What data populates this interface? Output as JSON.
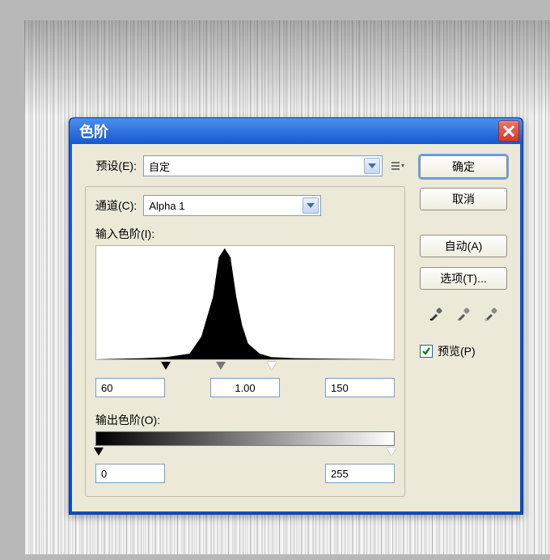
{
  "dialog": {
    "title": "色阶",
    "preset_label": "预设(E):",
    "preset_value": "自定",
    "channel_label": "通道(C):",
    "channel_value": "Alpha 1",
    "input_levels_label": "输入色阶(I):",
    "input_levels": {
      "shadow": "60",
      "mid": "1.00",
      "highlight": "150"
    },
    "output_levels_label": "输出色阶(O):",
    "output_levels": {
      "low": "0",
      "high": "255"
    }
  },
  "buttons": {
    "ok": "确定",
    "cancel": "取消",
    "auto": "自动(A)",
    "options": "选项(T)..."
  },
  "preview_label": "预览(P)",
  "preview_checked": true,
  "chart_data": {
    "type": "area",
    "title": "",
    "xlabel": "",
    "ylabel": "",
    "xlim": [
      0,
      255
    ],
    "ylim": [
      0,
      1
    ],
    "series": [
      {
        "name": "histogram",
        "x": [
          0,
          40,
          60,
          80,
          90,
          100,
          105,
          110,
          115,
          120,
          125,
          130,
          140,
          150,
          170,
          200,
          255
        ],
        "values": [
          0,
          0.01,
          0.02,
          0.05,
          0.2,
          0.55,
          0.9,
          0.98,
          0.9,
          0.55,
          0.3,
          0.14,
          0.05,
          0.02,
          0.01,
          0.005,
          0
        ]
      }
    ],
    "sliders": {
      "black": 60,
      "gray": 107,
      "white": 150
    }
  }
}
